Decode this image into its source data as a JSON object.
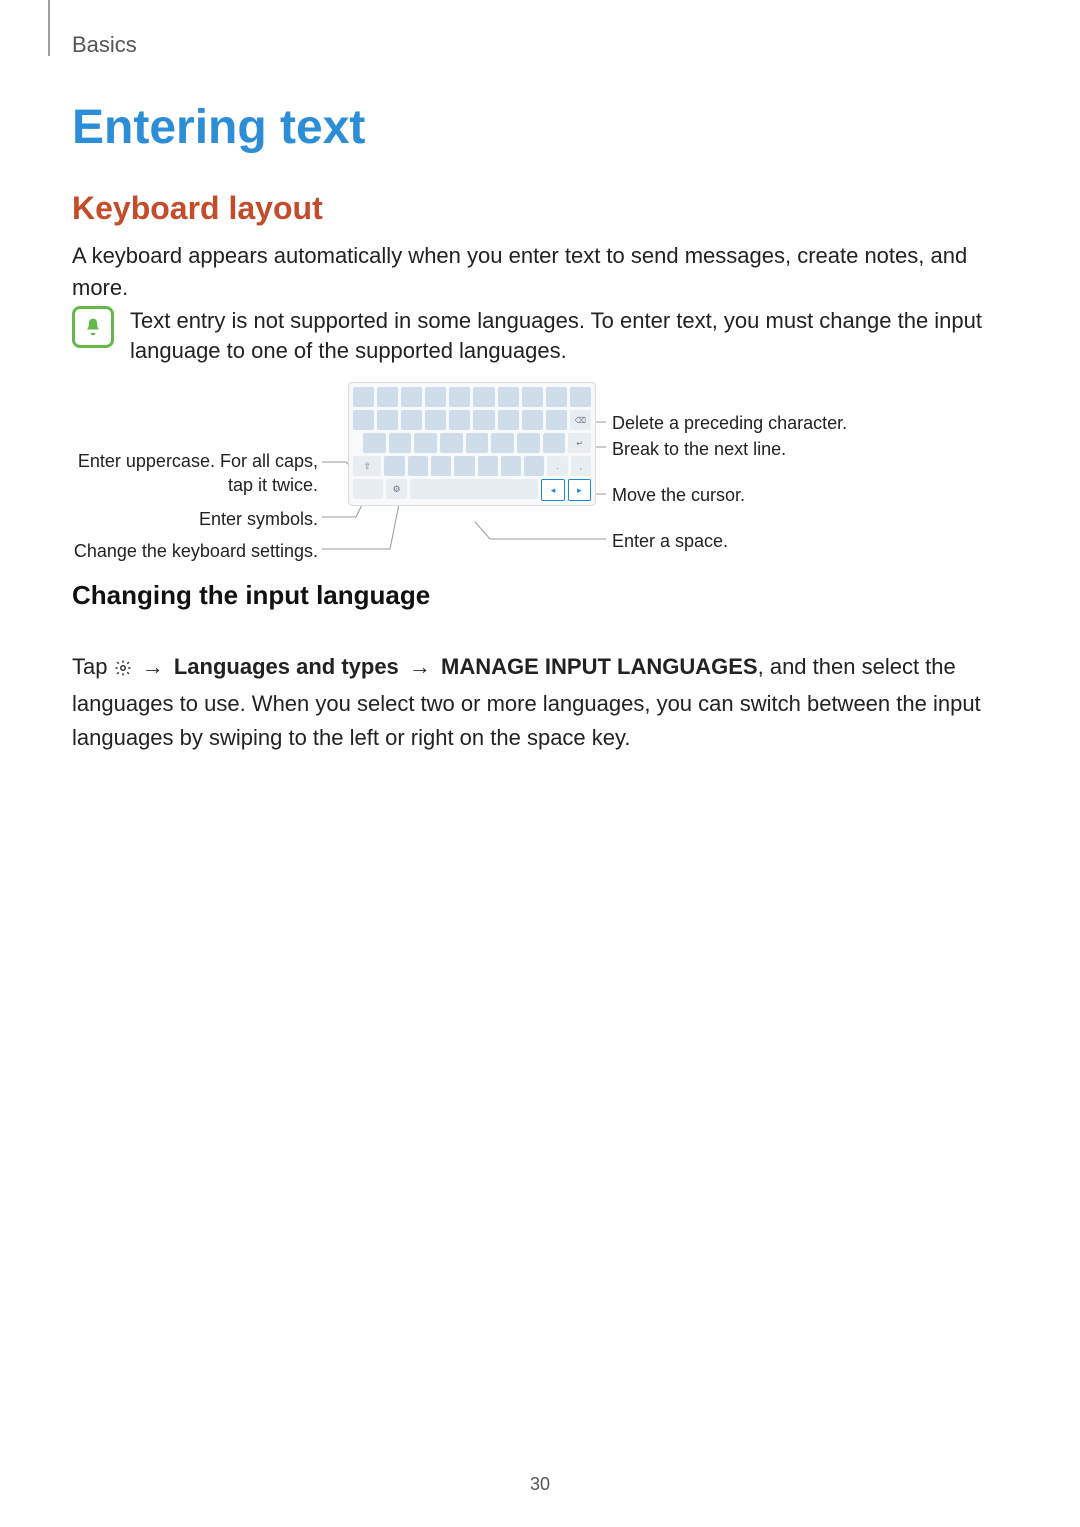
{
  "header": {
    "breadcrumb": "Basics"
  },
  "titles": {
    "page": "Entering text",
    "section": "Keyboard layout",
    "sub": "Changing the input language"
  },
  "intro": "A keyboard appears automatically when you enter text to send messages, create notes, and more.",
  "note": "Text entry is not supported in some languages. To enter text, you must change the input language to one of the supported languages.",
  "callouts": {
    "left": {
      "shift_1": "Enter uppercase. For all caps,",
      "shift_2": "tap it twice.",
      "symbols": "Enter symbols.",
      "settings": "Change the keyboard settings."
    },
    "right": {
      "delete": "Delete a preceding character.",
      "return": "Break to the next line.",
      "cursor": "Move the cursor.",
      "space": "Enter a space."
    }
  },
  "instruction": {
    "prefix": "Tap ",
    "step1": "Languages and types",
    "step2": "MANAGE INPUT LANGUAGES",
    "suffix": ", and then select the languages to use. When you select two or more languages, you can switch between the input languages by swiping to the left or right on the space key."
  },
  "page_number": "30"
}
